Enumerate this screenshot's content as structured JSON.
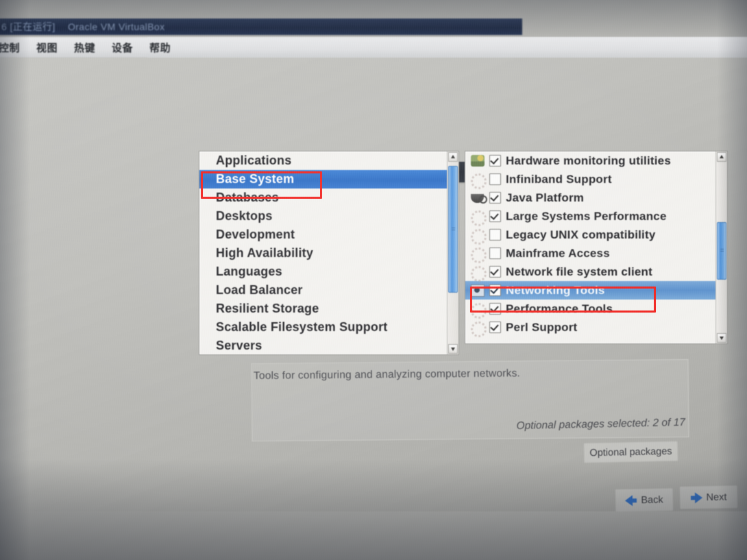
{
  "window": {
    "title_prefix": "6 [正在运行]",
    "title_app": "Oracle VM VirtualBox",
    "menu": [
      {
        "name": "control",
        "label": "控制"
      },
      {
        "name": "view",
        "label": "视图"
      },
      {
        "name": "hotkeys",
        "label": "热键"
      },
      {
        "name": "devices",
        "label": "设备"
      },
      {
        "name": "help",
        "label": "帮助"
      }
    ]
  },
  "installer": {
    "left_panel": {
      "name": "package-group-list",
      "items": [
        {
          "label": "Applications",
          "selected": false
        },
        {
          "label": "Base System",
          "selected": true
        },
        {
          "label": "Databases",
          "selected": false
        },
        {
          "label": "Desktops",
          "selected": false
        },
        {
          "label": "Development",
          "selected": false
        },
        {
          "label": "High Availability",
          "selected": false
        },
        {
          "label": "Languages",
          "selected": false
        },
        {
          "label": "Load Balancer",
          "selected": false
        },
        {
          "label": "Resilient Storage",
          "selected": false
        },
        {
          "label": "Scalable Filesystem Support",
          "selected": false
        },
        {
          "label": "Servers",
          "selected": false
        }
      ],
      "scroll": {
        "thumb_top_pct": 2,
        "thumb_height_pct": 70
      }
    },
    "right_panel": {
      "name": "package-option-list",
      "items": [
        {
          "label": "Hardware monitoring utilities",
          "checked": true,
          "icon": "hardware-icon",
          "selected": false
        },
        {
          "label": "Infiniband Support",
          "checked": false,
          "icon": "gear-icon",
          "selected": false
        },
        {
          "label": "Java Platform",
          "checked": true,
          "icon": "java-coffee-icon",
          "selected": false
        },
        {
          "label": "Large Systems Performance",
          "checked": true,
          "icon": "gear-icon",
          "selected": false
        },
        {
          "label": "Legacy UNIX compatibility",
          "checked": false,
          "icon": "gear-icon",
          "selected": false
        },
        {
          "label": "Mainframe Access",
          "checked": false,
          "icon": "gear-icon",
          "selected": false
        },
        {
          "label": "Network file system client",
          "checked": true,
          "icon": "gear-icon",
          "selected": false
        },
        {
          "label": "Networking Tools",
          "checked": true,
          "icon": "network-icon",
          "selected": true
        },
        {
          "label": "Performance Tools",
          "checked": true,
          "icon": "gear-icon",
          "selected": false
        },
        {
          "label": "Perl Support",
          "checked": true,
          "icon": "gear-icon",
          "selected": false
        }
      ],
      "scroll": {
        "thumb_top_pct": 35,
        "thumb_height_pct": 34
      }
    },
    "description": "Tools for configuring and analyzing computer networks.",
    "optional_selected_text": "Optional packages selected: 2 of 17",
    "buttons": {
      "optional_packages": "Optional packages",
      "back": "Back",
      "next": "Next"
    }
  },
  "annotations": {
    "color": "#f2241f",
    "boxes": [
      {
        "name": "annot-base-system",
        "target": "Base System"
      },
      {
        "name": "annot-networking-tools",
        "target": "Networking Tools"
      }
    ]
  }
}
